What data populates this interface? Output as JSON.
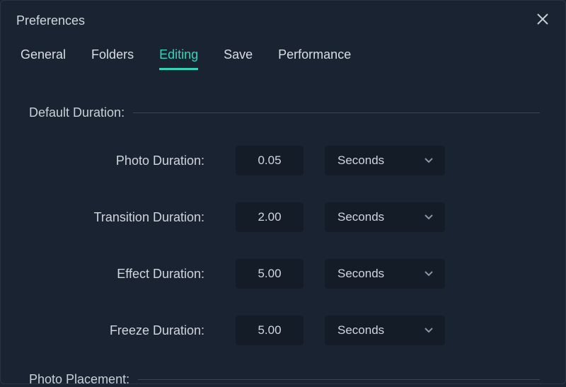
{
  "window": {
    "title": "Preferences"
  },
  "tabs": {
    "general": "General",
    "folders": "Folders",
    "editing": "Editing",
    "save": "Save",
    "performance": "Performance",
    "active": "editing"
  },
  "sections": {
    "default_duration": {
      "label": "Default Duration:",
      "photo": {
        "label": "Photo Duration:",
        "value": "0.05",
        "unit": "Seconds"
      },
      "transition": {
        "label": "Transition Duration:",
        "value": "2.00",
        "unit": "Seconds"
      },
      "effect": {
        "label": "Effect Duration:",
        "value": "5.00",
        "unit": "Seconds"
      },
      "freeze": {
        "label": "Freeze Duration:",
        "value": "5.00",
        "unit": "Seconds"
      }
    },
    "photo_placement": {
      "label": "Photo Placement:"
    }
  }
}
